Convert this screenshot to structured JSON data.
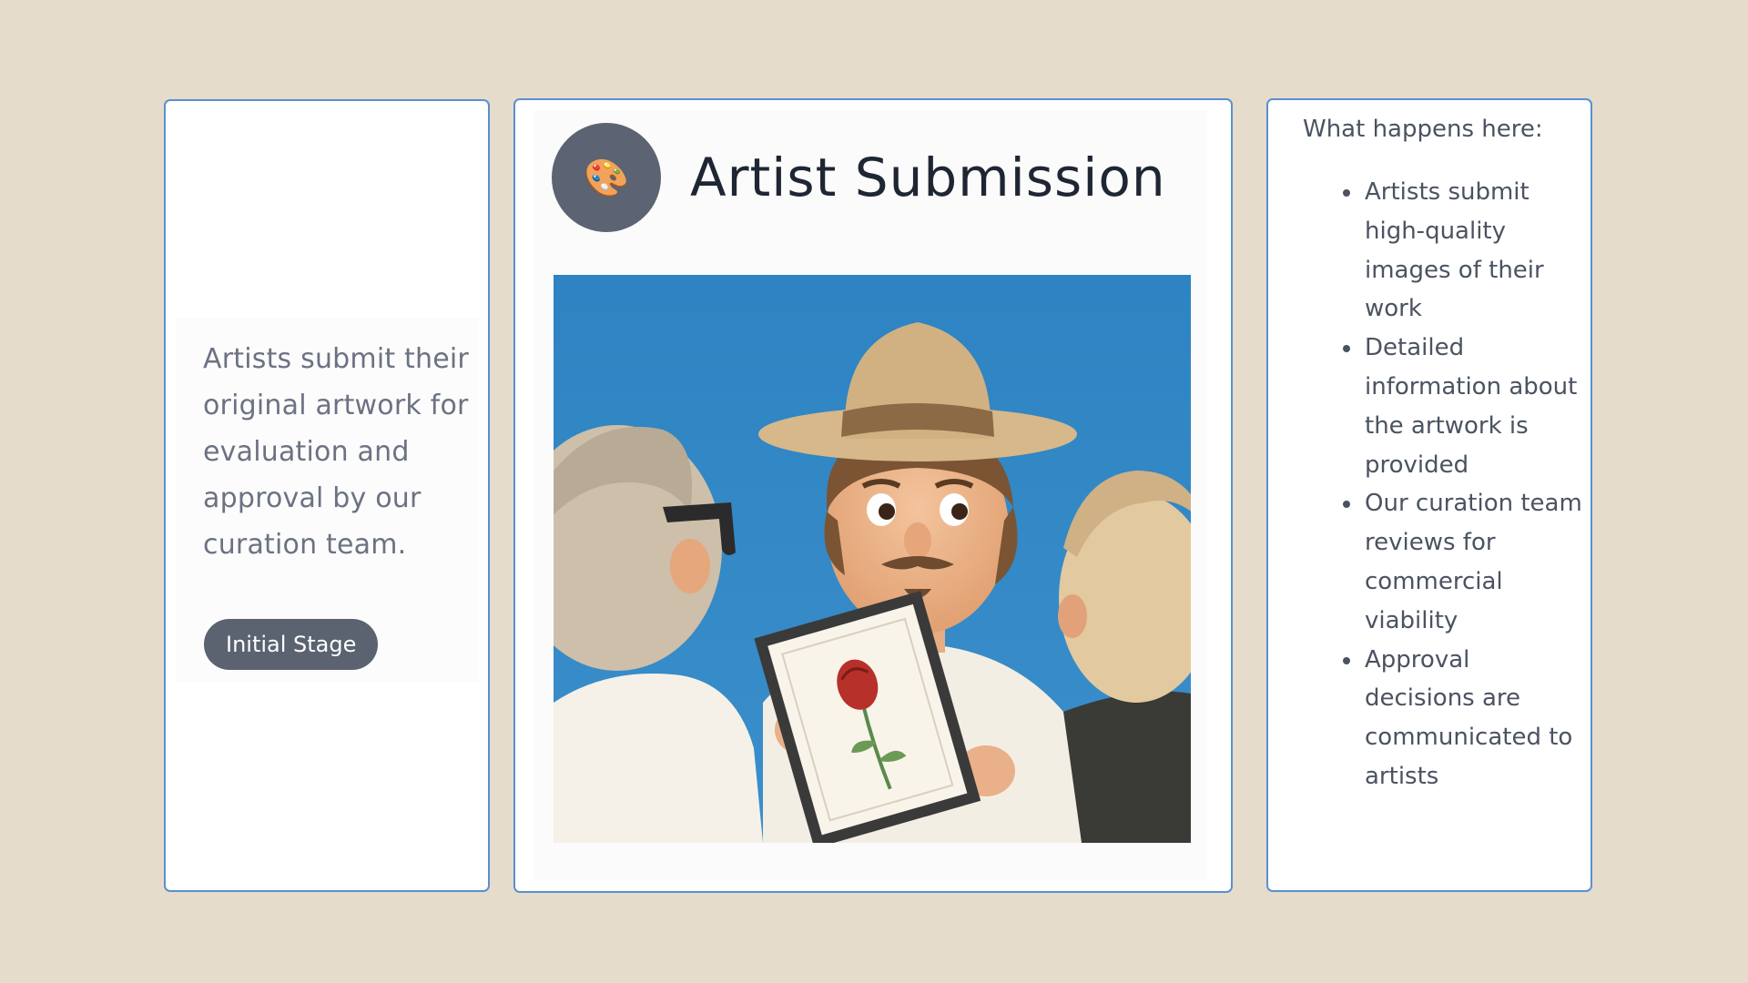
{
  "left_panel": {
    "description": "Artists submit their original artwork for evaluation and approval by our curation team.",
    "stage_badge": "Initial Stage"
  },
  "main": {
    "icon": "artist-palette-icon",
    "icon_glyph": "🎨",
    "title": "Artist Submission",
    "image": "illustration-artist-presenting-framed-rose-drawing"
  },
  "right_panel": {
    "heading": "What happens here:",
    "items": [
      {
        "text": "Artists submit high-quality images of their work"
      },
      {
        "text": "Detailed information about the artwork is provided"
      },
      {
        "text": "Our curation team reviews for commercial viability"
      },
      {
        "text": "Approval decisions are communicated to artists"
      }
    ]
  },
  "colors": {
    "page_background": "#e5dccb",
    "panel_border": "#5b8fd0",
    "badge_background": "#5b6270",
    "image_background": "#2f86c6"
  }
}
